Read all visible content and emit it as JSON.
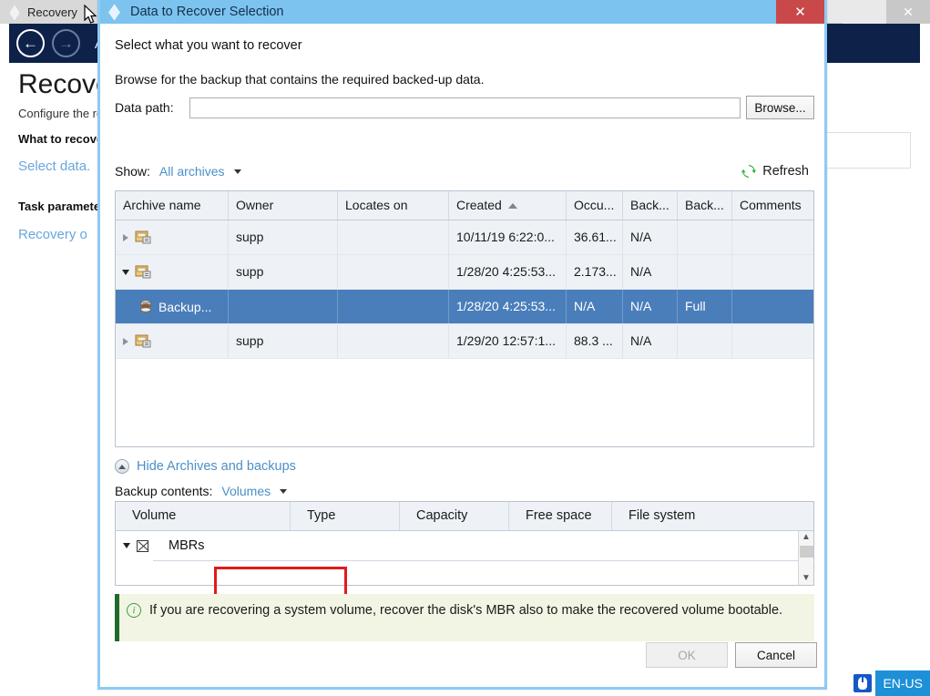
{
  "background_app": {
    "tab_label": "Recovery",
    "window_buttons": {
      "minimize": "",
      "close": "✕"
    },
    "nav": {
      "back_icon": "←",
      "forward_icon": "→",
      "trailing_text": "A"
    },
    "page_title": "Recove",
    "subtitle": "Configure the re",
    "section_what_to_recover": "What to recover",
    "link_select_data": "Select data.",
    "section_task_parameters": "Task parameters",
    "link_recovery_options": "Recovery o"
  },
  "taskbar": {
    "keyboard_icon": "keyboard-icon",
    "language": "EN-US"
  },
  "dialog": {
    "title": "Data to Recover Selection",
    "close_label": "✕",
    "heading": "Select what you want to recover",
    "description": "Browse for the backup that contains the required backed-up data.",
    "data_path": {
      "label": "Data path:",
      "value": "",
      "placeholder": ""
    },
    "browse_button": "Browse...",
    "show": {
      "label": "Show:",
      "value": "All archives"
    },
    "refresh_button": "Refresh",
    "archives_table": {
      "columns": [
        "Archive name",
        "Owner",
        "Locates on",
        "Created",
        "Occu...",
        "Back...",
        "Back...",
        "Comments"
      ],
      "sort_column": "Created",
      "sort_direction": "ascending",
      "rows": [
        {
          "expander": "collapsed",
          "icon": "archive-icon",
          "name": "",
          "owner": "supp",
          "locates_on": "",
          "created": "10/11/19 6:22:0...",
          "occupied": "36.61...",
          "backup_col1": "N/A",
          "backup_col2": "",
          "comments": "",
          "selected": false
        },
        {
          "expander": "expanded",
          "icon": "archive-icon",
          "name": "",
          "owner": "supp",
          "locates_on": "",
          "created": "1/28/20 4:25:53...",
          "occupied": "2.173...",
          "backup_col1": "N/A",
          "backup_col2": "",
          "comments": "",
          "selected": false
        },
        {
          "expander": "none",
          "icon": "backup-icon",
          "name": "Backup...",
          "owner": "",
          "locates_on": "",
          "created": "1/28/20 4:25:53...",
          "occupied": "N/A",
          "backup_col1": "N/A",
          "backup_col2": "Full",
          "comments": "",
          "selected": true
        },
        {
          "expander": "collapsed",
          "icon": "archive-icon",
          "name": "",
          "owner": "supp",
          "locates_on": "",
          "created": "1/29/20 12:57:1...",
          "occupied": "88.3 ...",
          "backup_col1": "N/A",
          "backup_col2": "",
          "comments": "",
          "selected": false
        }
      ]
    },
    "hide_archives_link": "Hide Archives and backups",
    "backup_contents": {
      "label": "Backup contents:",
      "value": "Volumes"
    },
    "volumes_table": {
      "columns": [
        "Volume",
        "Type",
        "Capacity",
        "Free space",
        "File system"
      ],
      "rows": [
        {
          "expander": "expanded",
          "checkbox_state": "crossed",
          "volume": "MBRs",
          "type": "",
          "capacity": "",
          "free_space": "",
          "file_system": ""
        }
      ]
    },
    "info_message": "If you are recovering a system volume, recover the disk's MBR also to make the recovered volume bootable.",
    "ok_button": "OK",
    "cancel_button": "Cancel"
  },
  "colors": {
    "dialog_title_bar": "#7cc3f0",
    "dialog_close": "#c9484a",
    "selection_row": "#4a7ebb",
    "link": "#4a90c8",
    "info_bg": "#f2f5e3",
    "info_accent": "#1f6b2a",
    "highlight_box": "#e01b1b",
    "navbar": "#0d2149",
    "refresh_green": "#2cb42c",
    "lang_badge": "#1e90d8"
  }
}
